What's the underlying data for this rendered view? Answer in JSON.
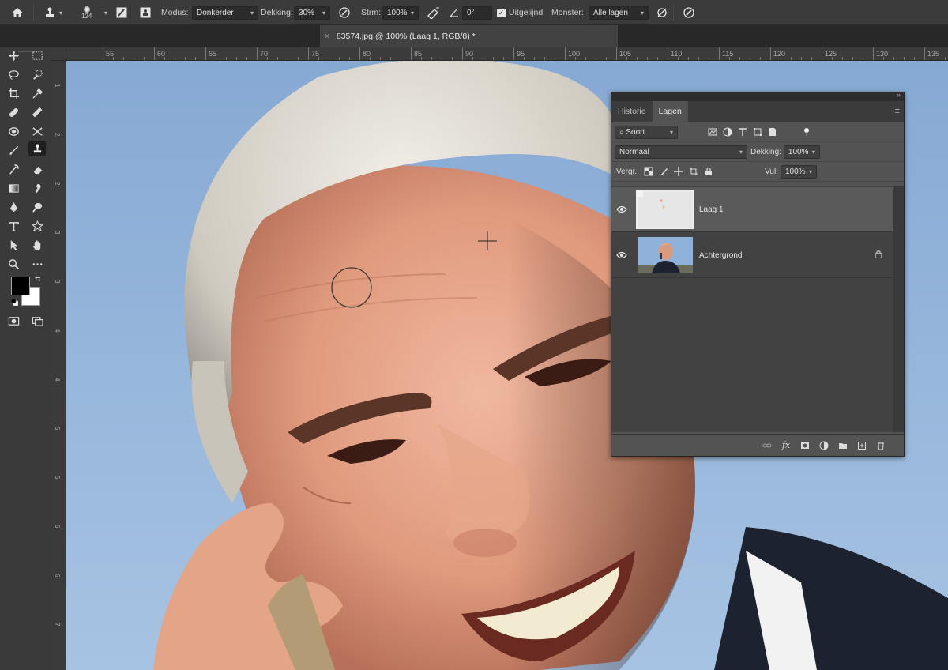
{
  "options_bar": {
    "brush_size": "124",
    "mode_label": "Modus:",
    "mode_value": "Donkerder",
    "opacity_label": "Dekking:",
    "opacity_value": "30%",
    "flow_label": "Strm:",
    "flow_value": "100%",
    "angle_value": "0°",
    "aligned_label": "Uitgelijnd",
    "aligned_checked": true,
    "sample_label": "Monster:",
    "sample_value": "Alle lagen"
  },
  "document": {
    "tab_title": "83574.jpg @ 100% (Laag 1, RGB/8) *",
    "close_glyph": "×"
  },
  "ruler": {
    "top_labels": [
      "55",
      "60",
      "65",
      "70",
      "75",
      "80",
      "85",
      "90",
      "95",
      "100",
      "105",
      "110",
      "115",
      "120",
      "125",
      "130",
      "135"
    ],
    "left_labels": [
      "1",
      "2",
      "2",
      "3",
      "3",
      "4",
      "4",
      "5",
      "5",
      "6",
      "6",
      "7",
      "7"
    ]
  },
  "layers_panel": {
    "tabs": [
      {
        "label": "Historie",
        "active": false
      },
      {
        "label": "Lagen",
        "active": true
      }
    ],
    "filter_label": "Soort",
    "blend_mode": "Normaal",
    "opacity_label": "Dekking:",
    "opacity_value": "100%",
    "lock_label": "Vergr.:",
    "fill_label": "Vul:",
    "fill_value": "100%",
    "layers": [
      {
        "name": "Laag 1",
        "visible": true,
        "selected": true,
        "locked": false
      },
      {
        "name": "Achtergrond",
        "visible": true,
        "selected": false,
        "locked": true
      }
    ],
    "footer_icons": [
      "link-icon",
      "fx-icon",
      "mask-icon",
      "adjustment-icon",
      "folder-icon",
      "new-layer-icon",
      "trash-icon"
    ],
    "fx_glyph": "fx"
  },
  "colors": {
    "foreground": "#000000",
    "background": "#ffffff",
    "sky": "#8fb0d6",
    "panel": "#535353"
  }
}
